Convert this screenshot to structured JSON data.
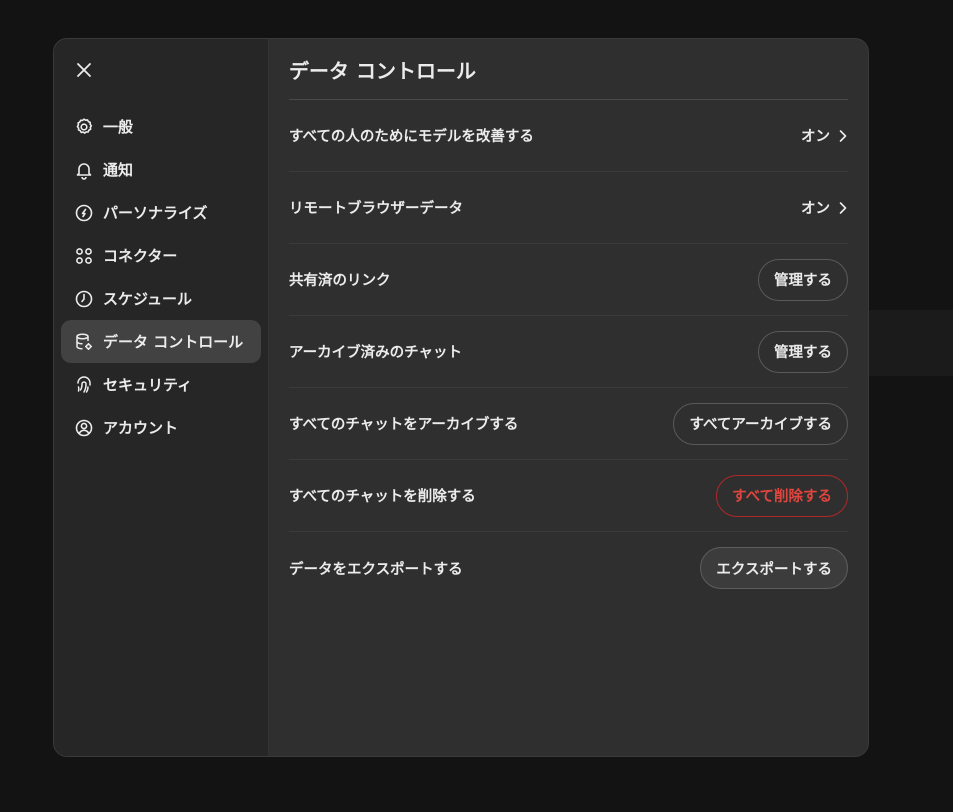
{
  "sidebar": {
    "items": [
      {
        "label": "一般",
        "icon": "gear-icon"
      },
      {
        "label": "通知",
        "icon": "bell-icon"
      },
      {
        "label": "パーソナライズ",
        "icon": "personalize-icon"
      },
      {
        "label": "コネクター",
        "icon": "connectors-icon"
      },
      {
        "label": "スケジュール",
        "icon": "clock-icon"
      },
      {
        "label": "データ コントロール",
        "icon": "database-gear-icon",
        "active": true
      },
      {
        "label": "セキュリティ",
        "icon": "fingerprint-icon"
      },
      {
        "label": "アカウント",
        "icon": "account-icon"
      }
    ]
  },
  "main": {
    "title": "データ コントロール",
    "rows": [
      {
        "label": "すべての人のためにモデルを改善する",
        "value": "オン"
      },
      {
        "label": "リモートブラウザーデータ",
        "value": "オン"
      },
      {
        "label": "共有済のリンク",
        "button": "管理する"
      },
      {
        "label": "アーカイブ済みのチャット",
        "button": "管理する"
      },
      {
        "label": "すべてのチャットをアーカイブする",
        "button": "すべてアーカイブする"
      },
      {
        "label": "すべてのチャットを削除する",
        "button": "すべて削除する"
      },
      {
        "label": "データをエクスポートする",
        "button": "エクスポートする"
      }
    ]
  },
  "colors": {
    "danger": "#e0453e",
    "modal_bg": "#2f2f2f",
    "sidebar_bg": "#262626"
  }
}
